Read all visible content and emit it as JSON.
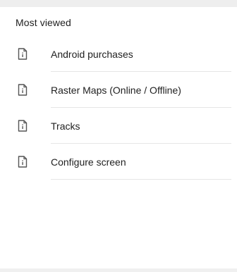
{
  "section": {
    "title": "Most viewed"
  },
  "items": [
    {
      "label": "Android purchases",
      "icon": "file-info-icon"
    },
    {
      "label": "Raster Maps (Online / Offline)",
      "icon": "file-info-icon"
    },
    {
      "label": "Tracks",
      "icon": "file-info-icon"
    },
    {
      "label": "Configure screen",
      "icon": "file-info-icon"
    }
  ]
}
